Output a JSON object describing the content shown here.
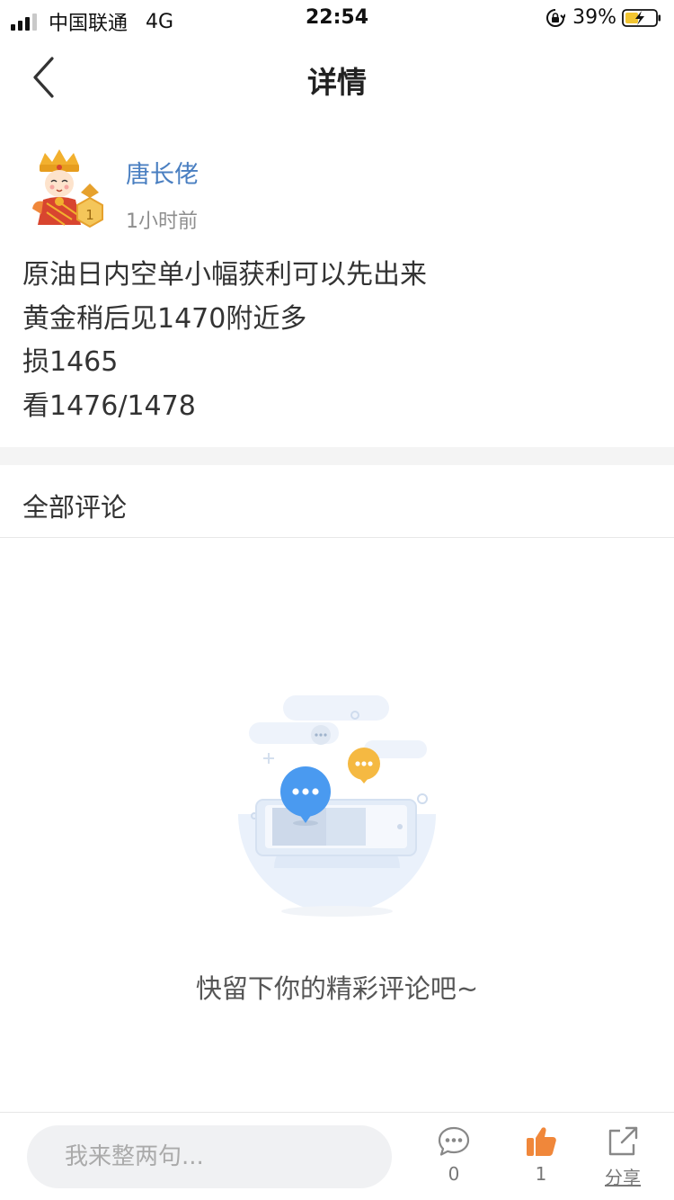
{
  "status_bar": {
    "carrier": "中国联通",
    "network": "4G",
    "time": "22:54",
    "battery": "39%"
  },
  "nav": {
    "title": "详情",
    "back_icon": "chevron-left-icon"
  },
  "post": {
    "author": "唐长佬",
    "time_ago": "1小时前",
    "avatar_badge": "1",
    "lines": [
      "原油日内空单小幅获利可以先出来",
      "黄金稍后见1470附近多",
      "损1465",
      "看1476/1478"
    ]
  },
  "comments": {
    "title": "全部评论",
    "empty_text": "快留下你的精彩评论吧~"
  },
  "bottom_bar": {
    "input_placeholder": "我来整两句...",
    "comment_count": "0",
    "like_count": "1",
    "share_label": "分享"
  },
  "colors": {
    "author_name": "#4a7fc1",
    "like_icon": "#f0873a",
    "bubble_blue": "#4a9af0",
    "bubble_yellow": "#f5b942"
  }
}
